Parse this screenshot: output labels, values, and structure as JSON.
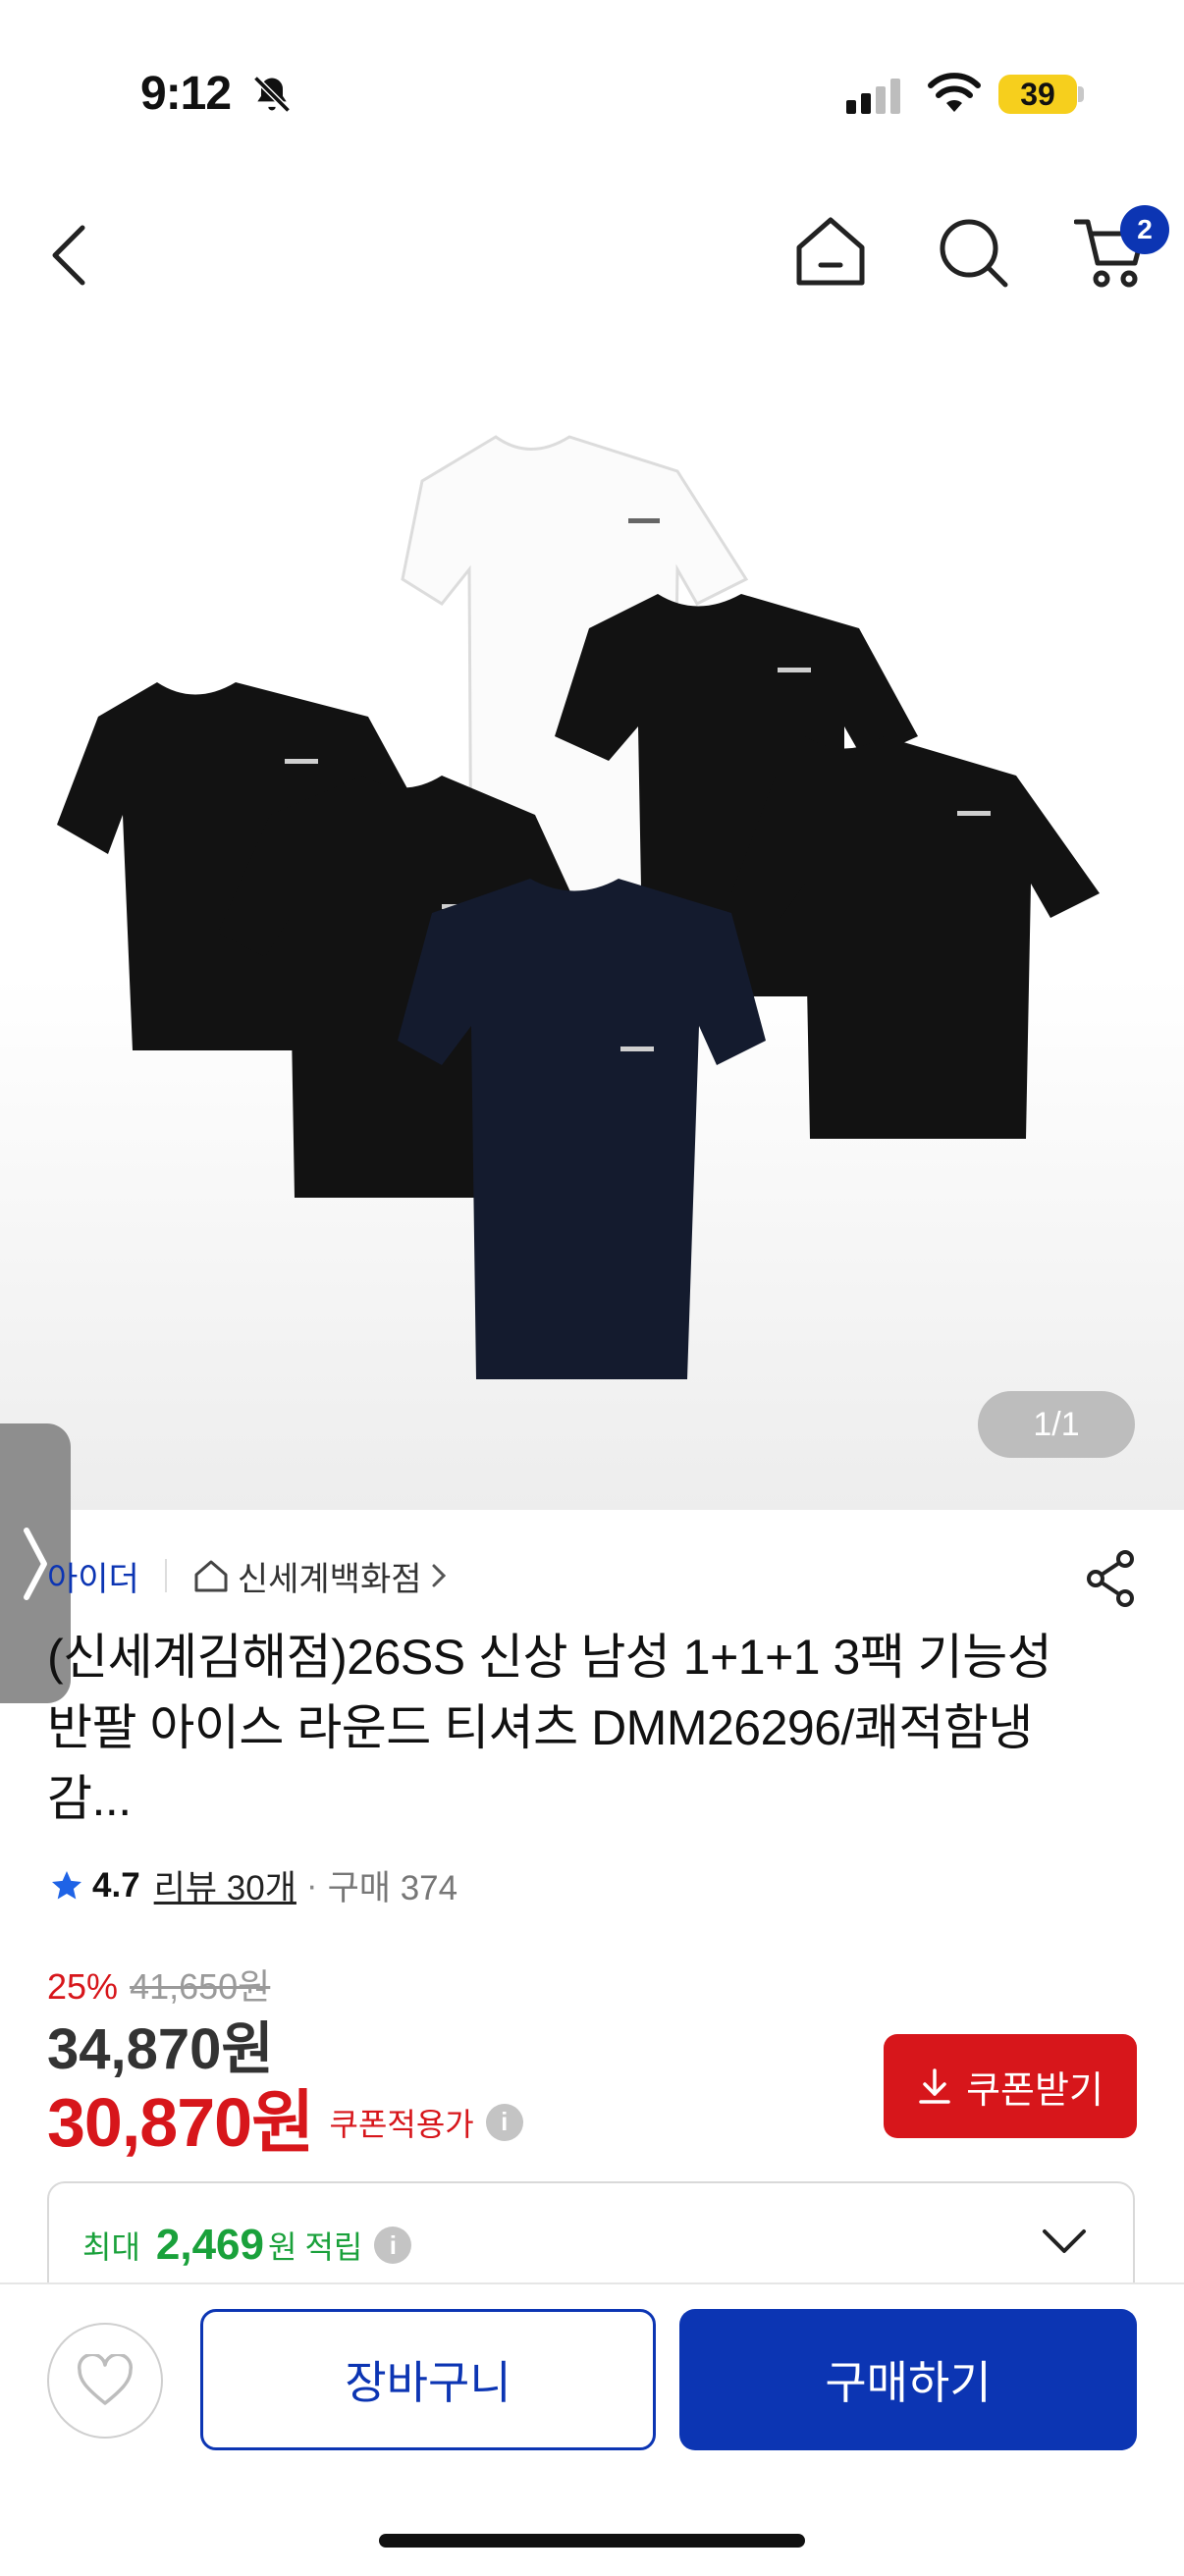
{
  "status_bar": {
    "time": "9:12",
    "battery": "39"
  },
  "header": {
    "cart_count": "2"
  },
  "gallery": {
    "counter": "1/1"
  },
  "product": {
    "brand": "아이더",
    "store": "신세계백화점",
    "title": "(신세계김해점)26SS 신상 남성 1+1+1 3팩 기능성 반팔 아이스 라운드 티셔츠 DMM26296/쾌적함냉감...",
    "rating": "4.7",
    "review": "리뷰 30개",
    "dot": "·",
    "purchase": "구매 374",
    "discount_pct": "25%",
    "original_price": "41,650원",
    "price": "34,870원",
    "sale_price": "30,870원",
    "coupon_note": "쿠폰적용가",
    "info_mark": "i",
    "coupon_button": "쿠폰받기",
    "points_prefix": "최대",
    "points_value": "2,469",
    "points_unit": "원",
    "points_suffix": "적립"
  },
  "actions": {
    "cart": "장바구니",
    "buy": "구매하기"
  },
  "colors": {
    "brand_blue": "#0c35b3",
    "sale_red": "#d7161b",
    "points_green": "#1aa13b",
    "battery_yellow": "#f6cf1d"
  }
}
